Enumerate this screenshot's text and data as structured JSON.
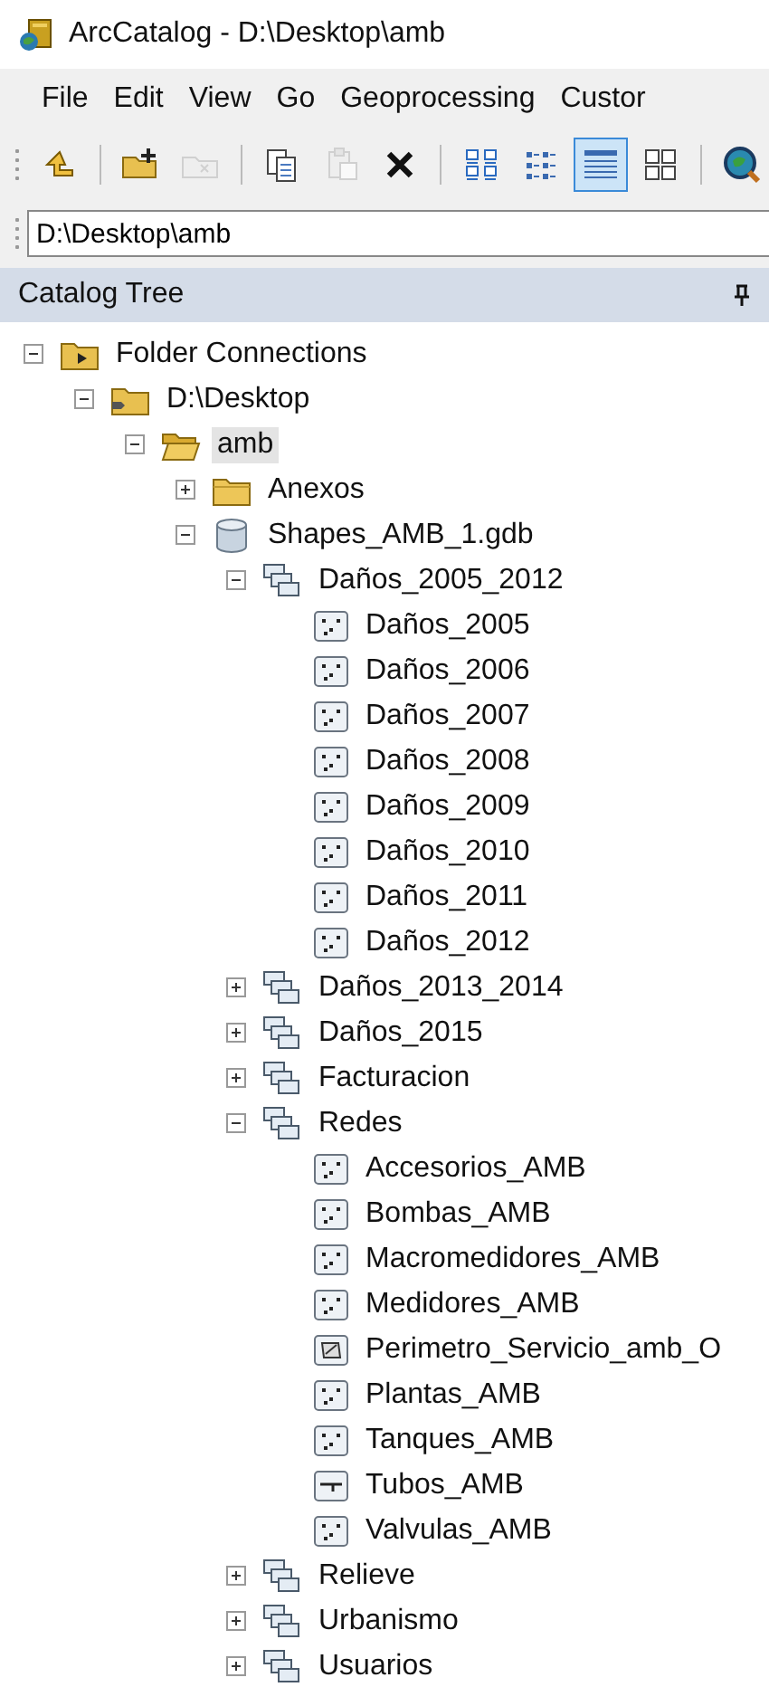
{
  "window": {
    "title": "ArcCatalog - D:\\Desktop\\amb"
  },
  "menu": [
    "File",
    "Edit",
    "View",
    "Go",
    "Geoprocessing",
    "Custor"
  ],
  "toolbar": [
    [
      {
        "kind": "up",
        "disabled": false,
        "active": false
      }
    ],
    [
      {
        "kind": "connect-folder",
        "disabled": false,
        "active": false
      },
      {
        "kind": "disconnect-folder",
        "disabled": true,
        "active": false
      }
    ],
    [
      {
        "kind": "copy",
        "disabled": false,
        "active": false
      },
      {
        "kind": "paste",
        "disabled": true,
        "active": false
      },
      {
        "kind": "delete",
        "disabled": false,
        "active": false
      }
    ],
    [
      {
        "kind": "large-icons",
        "disabled": false,
        "active": false
      },
      {
        "kind": "list",
        "disabled": false,
        "active": false
      },
      {
        "kind": "details",
        "disabled": false,
        "active": true
      },
      {
        "kind": "thumbnails",
        "disabled": false,
        "active": false
      }
    ],
    [
      {
        "kind": "search",
        "disabled": false,
        "active": false
      }
    ]
  ],
  "location": {
    "value": "D:\\Desktop\\amb"
  },
  "panel": {
    "title": "Catalog Tree"
  },
  "tree": [
    {
      "label": "Folder Connections",
      "kind": "connections",
      "expanded": true,
      "selected": false,
      "children": [
        {
          "label": "D:\\Desktop",
          "kind": "folder-link",
          "expanded": true,
          "selected": false,
          "children": [
            {
              "label": "amb",
              "kind": "folder-open",
              "expanded": true,
              "selected": true,
              "children": [
                {
                  "label": "Anexos",
                  "kind": "folder",
                  "expanded": false,
                  "selected": false
                },
                {
                  "label": "Shapes_AMB_1.gdb",
                  "kind": "gdb",
                  "expanded": true,
                  "selected": false,
                  "children": [
                    {
                      "label": "Daños_2005_2012",
                      "kind": "dataset",
                      "expanded": true,
                      "selected": false,
                      "children": [
                        {
                          "label": "Daños_2005",
                          "kind": "point",
                          "selected": false
                        },
                        {
                          "label": "Daños_2006",
                          "kind": "point",
                          "selected": false
                        },
                        {
                          "label": "Daños_2007",
                          "kind": "point",
                          "selected": false
                        },
                        {
                          "label": "Daños_2008",
                          "kind": "point",
                          "selected": false
                        },
                        {
                          "label": "Daños_2009",
                          "kind": "point",
                          "selected": false
                        },
                        {
                          "label": "Daños_2010",
                          "kind": "point",
                          "selected": false
                        },
                        {
                          "label": "Daños_2011",
                          "kind": "point",
                          "selected": false
                        },
                        {
                          "label": "Daños_2012",
                          "kind": "point",
                          "selected": false
                        }
                      ]
                    },
                    {
                      "label": "Daños_2013_2014",
                      "kind": "dataset",
                      "expanded": false,
                      "selected": false
                    },
                    {
                      "label": "Daños_2015",
                      "kind": "dataset",
                      "expanded": false,
                      "selected": false
                    },
                    {
                      "label": "Facturacion",
                      "kind": "dataset",
                      "expanded": false,
                      "selected": false
                    },
                    {
                      "label": "Redes",
                      "kind": "dataset",
                      "expanded": true,
                      "selected": false,
                      "children": [
                        {
                          "label": "Accesorios_AMB",
                          "kind": "point",
                          "selected": false
                        },
                        {
                          "label": "Bombas_AMB",
                          "kind": "point",
                          "selected": false
                        },
                        {
                          "label": "Macromedidores_AMB",
                          "kind": "point",
                          "selected": false
                        },
                        {
                          "label": "Medidores_AMB",
                          "kind": "point",
                          "selected": false
                        },
                        {
                          "label": "Perimetro_Servicio_amb_O",
                          "kind": "polygon",
                          "selected": false
                        },
                        {
                          "label": "Plantas_AMB",
                          "kind": "point",
                          "selected": false
                        },
                        {
                          "label": "Tanques_AMB",
                          "kind": "point",
                          "selected": false
                        },
                        {
                          "label": "Tubos_AMB",
                          "kind": "line",
                          "selected": false
                        },
                        {
                          "label": "Valvulas_AMB",
                          "kind": "point",
                          "selected": false
                        }
                      ]
                    },
                    {
                      "label": "Relieve",
                      "kind": "dataset",
                      "expanded": false,
                      "selected": false
                    },
                    {
                      "label": "Urbanismo",
                      "kind": "dataset",
                      "expanded": false,
                      "selected": false
                    },
                    {
                      "label": "Usuarios",
                      "kind": "dataset",
                      "expanded": false,
                      "selected": false
                    }
                  ]
                }
              ]
            }
          ]
        }
      ]
    }
  ]
}
